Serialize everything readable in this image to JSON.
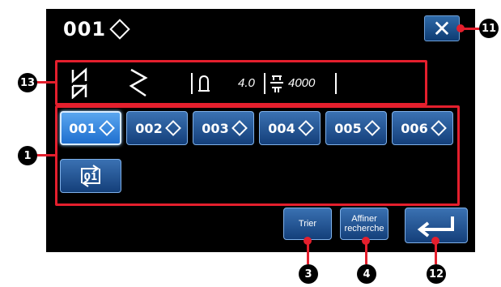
{
  "title": {
    "pattern": "001"
  },
  "close_icon": "close-icon",
  "info": {
    "stitch_length": "4.0",
    "speed": "4000"
  },
  "patterns": [
    {
      "label": "001",
      "selected": true
    },
    {
      "label": "002",
      "selected": false
    },
    {
      "label": "003",
      "selected": false
    },
    {
      "label": "004",
      "selected": false
    },
    {
      "label": "005",
      "selected": false
    },
    {
      "label": "006",
      "selected": false
    }
  ],
  "cycle_label": "01",
  "buttons": {
    "sort": "Trier",
    "refine_line1": "Affiner",
    "refine_line2": "recherche"
  },
  "callouts": {
    "c1": "1",
    "c3": "3",
    "c4": "4",
    "c11": "11",
    "c12": "12",
    "c13": "13"
  },
  "colors": {
    "accent": "#e41f2d",
    "button": "#1f4f8f",
    "selected": "#3b8ee0"
  }
}
